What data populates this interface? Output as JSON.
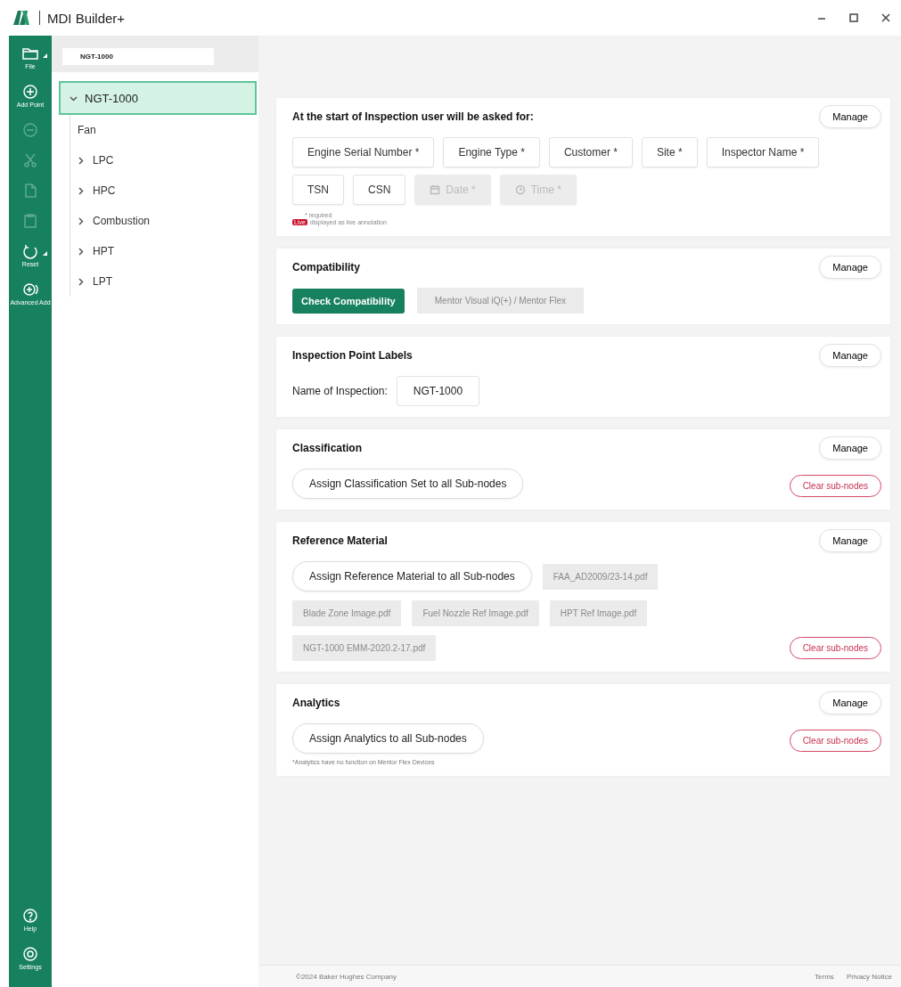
{
  "window": {
    "title": "MDI Builder+"
  },
  "rail": {
    "top": [
      {
        "kind": "file",
        "label": "File",
        "disabled": false,
        "has_menu": true
      },
      {
        "kind": "add",
        "label": "Add Point",
        "disabled": false,
        "has_menu": false
      },
      {
        "kind": "remove",
        "disabled": true,
        "has_menu": false
      },
      {
        "kind": "cut",
        "disabled": true,
        "has_menu": false
      },
      {
        "kind": "paste",
        "disabled": true,
        "has_menu": false
      },
      {
        "kind": "delete",
        "disabled": true,
        "has_menu": false
      },
      {
        "kind": "reset",
        "label": "Reset",
        "disabled": false,
        "has_menu": true
      },
      {
        "kind": "advanced",
        "label": "Advanced Add",
        "disabled": false,
        "has_menu": false
      }
    ],
    "bottom": [
      {
        "kind": "help",
        "label": "Help",
        "disabled": false,
        "has_menu": false
      },
      {
        "kind": "settings",
        "label": "Settings",
        "disabled": false,
        "has_menu": false
      }
    ]
  },
  "document_tab": {
    "label": "NGT-1000"
  },
  "tree": {
    "label": "NGT-1000",
    "expanded": true,
    "selected": true,
    "children": [
      {
        "label": "Fan",
        "expandable": false,
        "selected": false
      },
      {
        "label": "LPC",
        "expandable": true,
        "selected": false
      },
      {
        "label": "HPC",
        "expandable": true,
        "selected": false
      },
      {
        "label": "Combustion",
        "expandable": true,
        "selected": false
      },
      {
        "label": "HPT",
        "expandable": true,
        "selected": false
      },
      {
        "label": "LPT",
        "expandable": true,
        "selected": false
      }
    ]
  },
  "sections": [
    {
      "kind": "fields",
      "title": "At the start of Inspection user will be asked for:",
      "manage": "Manage",
      "fields": [
        {
          "kind": "text",
          "label": "Engine Serial Number *",
          "disabled": false
        },
        {
          "kind": "text",
          "label": "Engine Type *",
          "disabled": false
        },
        {
          "kind": "text",
          "label": "Customer *",
          "disabled": false
        },
        {
          "kind": "text",
          "label": "Site *",
          "disabled": false
        },
        {
          "kind": "text",
          "label": "Inspector Name *",
          "disabled": false
        },
        {
          "kind": "text",
          "label": "TSN",
          "disabled": false
        },
        {
          "kind": "text",
          "label": "CSN",
          "disabled": false
        },
        {
          "kind": "date",
          "label": "Date *",
          "disabled": true
        },
        {
          "kind": "time",
          "label": "Time *",
          "disabled": true
        }
      ],
      "required_note": "* required",
      "live_badge": "Live",
      "live_note": "displayed as live annotation"
    },
    {
      "kind": "compatibility",
      "title": "Compatibility",
      "manage": "Manage",
      "button": "Check Compatibility",
      "chips": [
        "Mentor Visual iQ(+) / Mentor Flex"
      ]
    },
    {
      "kind": "labels",
      "title": "Inspection Point Labels",
      "manage": "Manage",
      "label": "Name of Inspection:",
      "value": "NGT-1000"
    },
    {
      "kind": "assign",
      "title": "Classification",
      "manage": "Manage",
      "assign": "Assign Classification Set to all Sub-nodes",
      "clear": "Clear sub-nodes"
    },
    {
      "kind": "assign",
      "title": "Reference Material",
      "manage": "Manage",
      "assign": "Assign Reference Material to all Sub-nodes",
      "chips": [
        "FAA_AD2009/23-14.pdf",
        "Blade Zone Image.pdf",
        "Fuel Nozzle Ref Image.pdf",
        "HPT Ref Image.pdf",
        "NGT-1000 EMM-2020.2-17.pdf"
      ],
      "clear": "Clear sub-nodes"
    },
    {
      "kind": "assign",
      "title": "Analytics",
      "manage": "Manage",
      "assign": "Assign Analytics to all Sub-nodes",
      "clear": "Clear sub-nodes",
      "note": "*Analytics have no function on Mentor Flex Devices"
    }
  ],
  "footer": {
    "copyright": "©2024 Baker Hughes Company",
    "links": [
      "Terms",
      "Privacy Notice"
    ]
  }
}
